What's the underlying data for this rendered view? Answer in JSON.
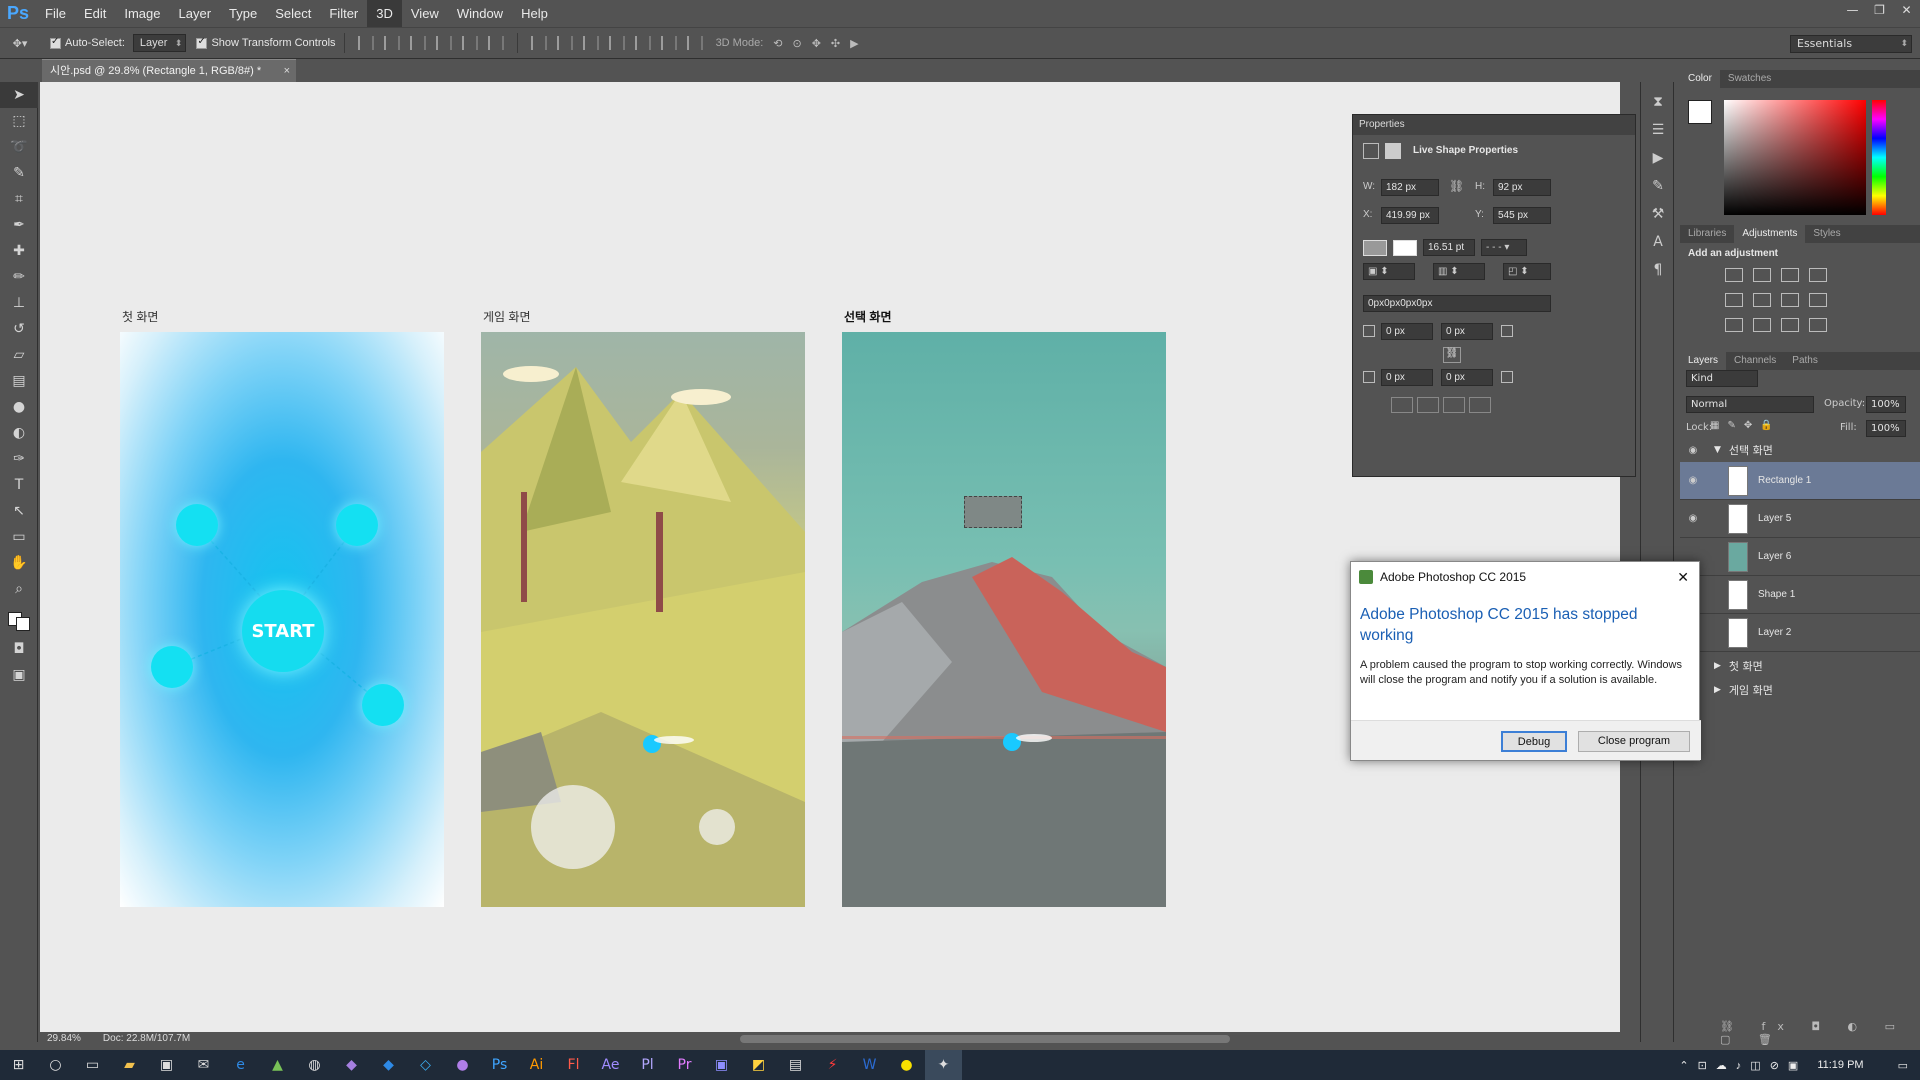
{
  "app": {
    "logo": "Ps"
  },
  "menu": [
    "File",
    "Edit",
    "Image",
    "Layer",
    "Type",
    "Select",
    "Filter",
    "3D",
    "View",
    "Window",
    "Help"
  ],
  "options": {
    "auto_select": "Auto-Select:",
    "layer_select": "Layer",
    "transform": "Show Transform Controls",
    "mode_3d": "3D Mode:",
    "workspace": "Essentials"
  },
  "document": {
    "tab_title": "시안.psd @ 29.8% (Rectangle 1, RGB/8#) *",
    "close": "×"
  },
  "artboards": [
    {
      "label": "첫 화면",
      "start_label": "START"
    },
    {
      "label": "게임 화면"
    },
    {
      "label": "선택 화면"
    }
  ],
  "status": {
    "zoom": "29.84%",
    "doc": "Doc: 22.8M/107.7M"
  },
  "properties": {
    "title": "Properties",
    "subtitle": "Live Shape Properties",
    "w_label": "W:",
    "w": "182 px",
    "h_label": "H:",
    "h": "92 px",
    "x_label": "X:",
    "x": "419.99 px",
    "y_label": "Y:",
    "y": "545 px",
    "stroke_width": "16.51 pt",
    "radius_combined": "0px0px0px0px",
    "radius": [
      "0 px",
      "0 px",
      "0 px",
      "0 px"
    ]
  },
  "color_panel": {
    "tabs": [
      "Color",
      "Swatches"
    ]
  },
  "adjustments": {
    "tabs": [
      "Libraries",
      "Adjustments",
      "Styles"
    ],
    "heading": "Add an adjustment"
  },
  "layers_panel": {
    "tabs": [
      "Layers",
      "Channels",
      "Paths"
    ],
    "kind": "Kind",
    "blend_mode": "Normal",
    "opacity_label": "Opacity:",
    "opacity": "100%",
    "lock_label": "Lock:",
    "fill_label": "Fill:",
    "fill": "100%",
    "open_group": "선택 화면",
    "layers": [
      "Rectangle 1",
      "Layer 5",
      "Layer 6",
      "Shape 1",
      "Layer 2"
    ],
    "groups": [
      "첫 화면",
      "게임 화면"
    ]
  },
  "dialog": {
    "title": "Adobe Photoshop CC 2015",
    "heading": "Adobe Photoshop CC 2015 has stopped working",
    "message": "A problem caused the program to stop working correctly. Windows will close the program and notify you if a solution is available.",
    "debug": "Debug",
    "close_program": "Close program"
  },
  "taskbar": {
    "time": "11:19 PM"
  },
  "colors": {
    "panel": "#535353",
    "canvas": "#ebebeb",
    "accent": "#1a5fb4",
    "selected_layer": "#6b7a96"
  }
}
